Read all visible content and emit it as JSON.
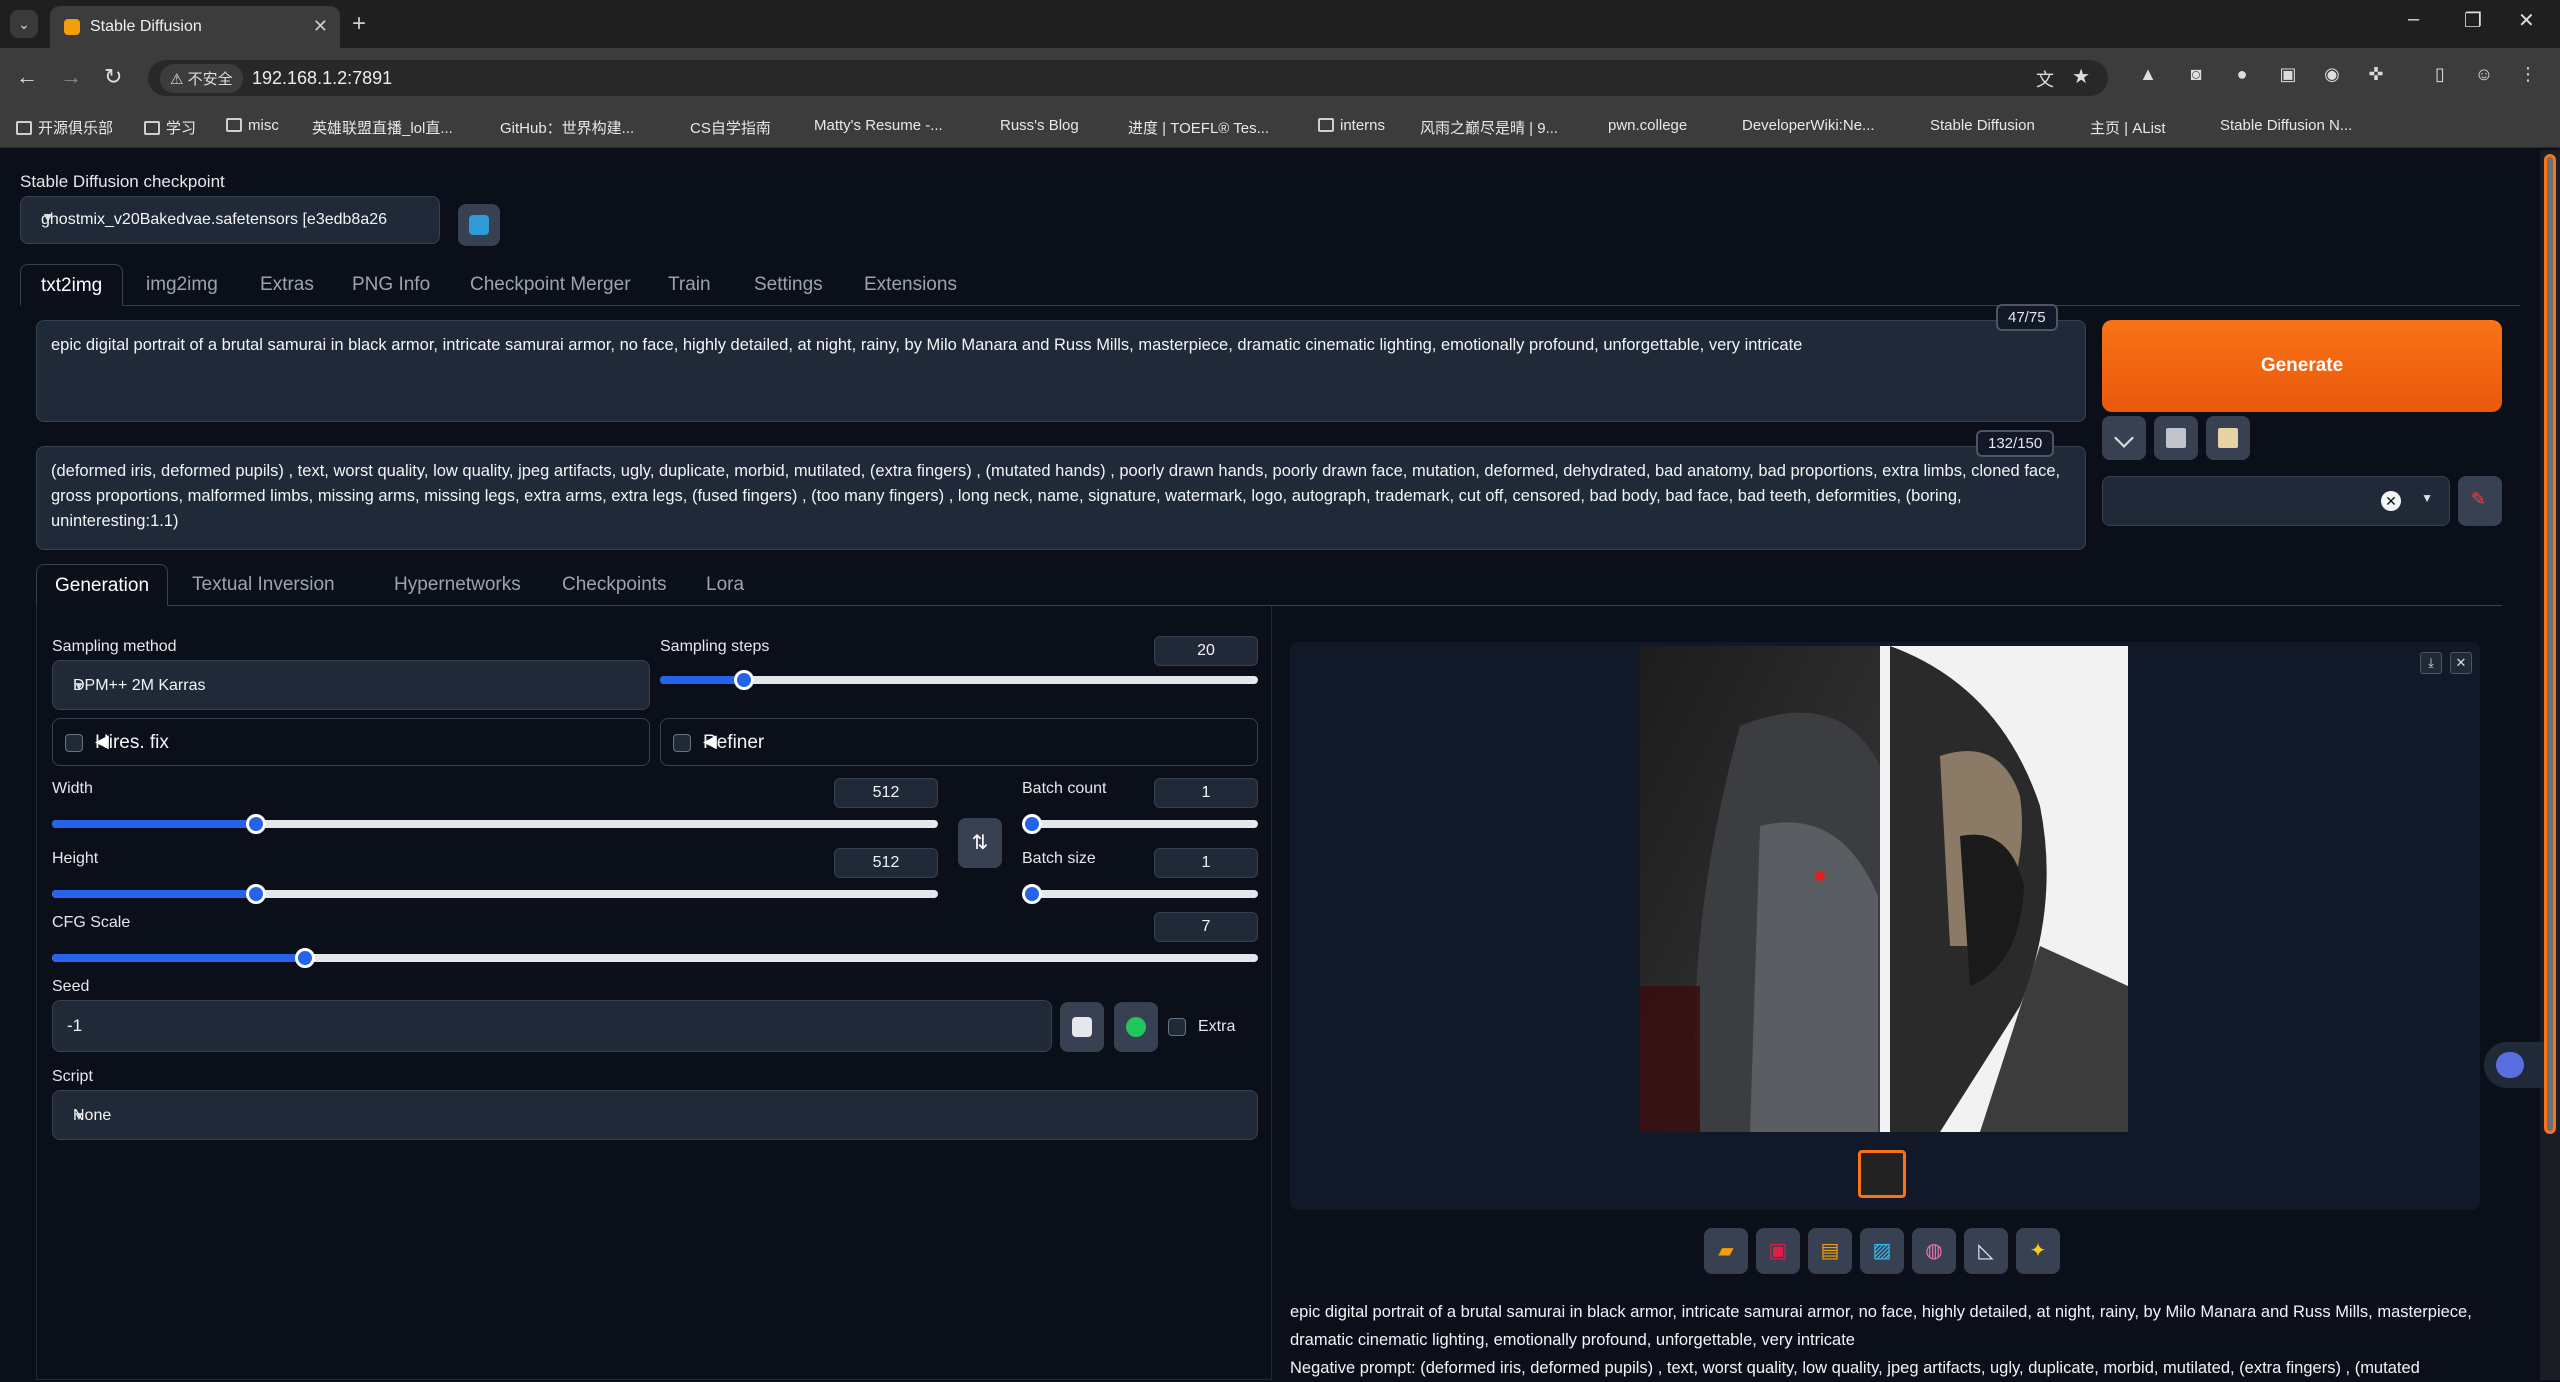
{
  "browser": {
    "tab_title": "Stable Diffusion",
    "insecure_label": "不安全",
    "url": "192.168.1.2:7891",
    "bookmarks": [
      "开源俱乐部",
      "学习",
      "misc",
      "英雄联盟直播_lol直...",
      "GitHub：世界构建...",
      "CS自学指南",
      "Matty's Resume -...",
      "Russ's Blog",
      "进度 | TOEFL® Tes...",
      "interns",
      "风雨之巅尽是晴 | 9...",
      "pwn.college",
      "DeveloperWiki:Ne...",
      "Stable Diffusion",
      "主页 | AList",
      "Stable Diffusion N..."
    ]
  },
  "checkpoint": {
    "label": "Stable Diffusion checkpoint",
    "value": "ghostmix_v20Bakedvae.safetensors [e3edb8a26"
  },
  "main_tabs": [
    "txt2img",
    "img2img",
    "Extras",
    "PNG Info",
    "Checkpoint Merger",
    "Train",
    "Settings",
    "Extensions"
  ],
  "prompt": {
    "text": "epic digital portrait of a brutal samurai in black armor, intricate samurai armor, no face, highly detailed, at night, rainy, by Milo Manara and Russ Mills, masterpiece, dramatic cinematic lighting, emotionally profound, unforgettable, very intricate",
    "counter": "47/75"
  },
  "negative_prompt": {
    "text": "(deformed iris, deformed pupils) , text, worst quality, low quality, jpeg artifacts, ugly, duplicate, morbid, mutilated, (extra fingers) , (mutated hands) , poorly drawn hands, poorly drawn face, mutation, deformed, dehydrated, bad anatomy, bad proportions, extra limbs, cloned face, gross proportions, malformed limbs, missing arms, missing legs, extra arms, extra legs, (fused fingers) , (too many fingers) , long neck, name, signature, watermark, logo, autograph, trademark, cut off, censored, bad body, bad face, bad teeth, deformities, (boring, uninteresting:1.1)",
    "counter": "132/150"
  },
  "generate_label": "Generate",
  "sub_tabs": [
    "Generation",
    "Textual Inversion",
    "Hypernetworks",
    "Checkpoints",
    "Lora"
  ],
  "generation": {
    "sampling_method_label": "Sampling method",
    "sampling_method": "DPM++ 2M Karras",
    "sampling_steps_label": "Sampling steps",
    "sampling_steps": "20",
    "hires_label": "Hires. fix",
    "refiner_label": "Refiner",
    "width_label": "Width",
    "width": "512",
    "height_label": "Height",
    "height": "512",
    "batch_count_label": "Batch count",
    "batch_count": "1",
    "batch_size_label": "Batch size",
    "batch_size": "1",
    "cfg_label": "CFG Scale",
    "cfg": "7",
    "seed_label": "Seed",
    "seed": "-1",
    "extra_label": "Extra",
    "script_label": "Script",
    "script": "None"
  },
  "sliders": {
    "sampling_steps_fraction": 0.14,
    "width_fraction": 0.23,
    "height_fraction": 0.23,
    "batch_count_fraction": 0.0,
    "batch_size_fraction": 0.0,
    "cfg_fraction": 0.21
  },
  "output": {
    "info_prompt": "epic digital portrait of a brutal samurai in black armor, intricate samurai armor, no face, highly detailed, at night, rainy, by Milo Manara and Russ Mills, masterpiece, dramatic cinematic lighting, emotionally profound, unforgettable, very intricate",
    "info_negative": "Negative prompt: (deformed iris, deformed pupils) , text, worst quality, low quality, jpeg artifacts, ugly, duplicate, morbid, mutilated, (extra fingers) , (mutated"
  },
  "colors": {
    "accent": "#f97316",
    "slider": "#2563eb",
    "background": "#0b0f19"
  }
}
